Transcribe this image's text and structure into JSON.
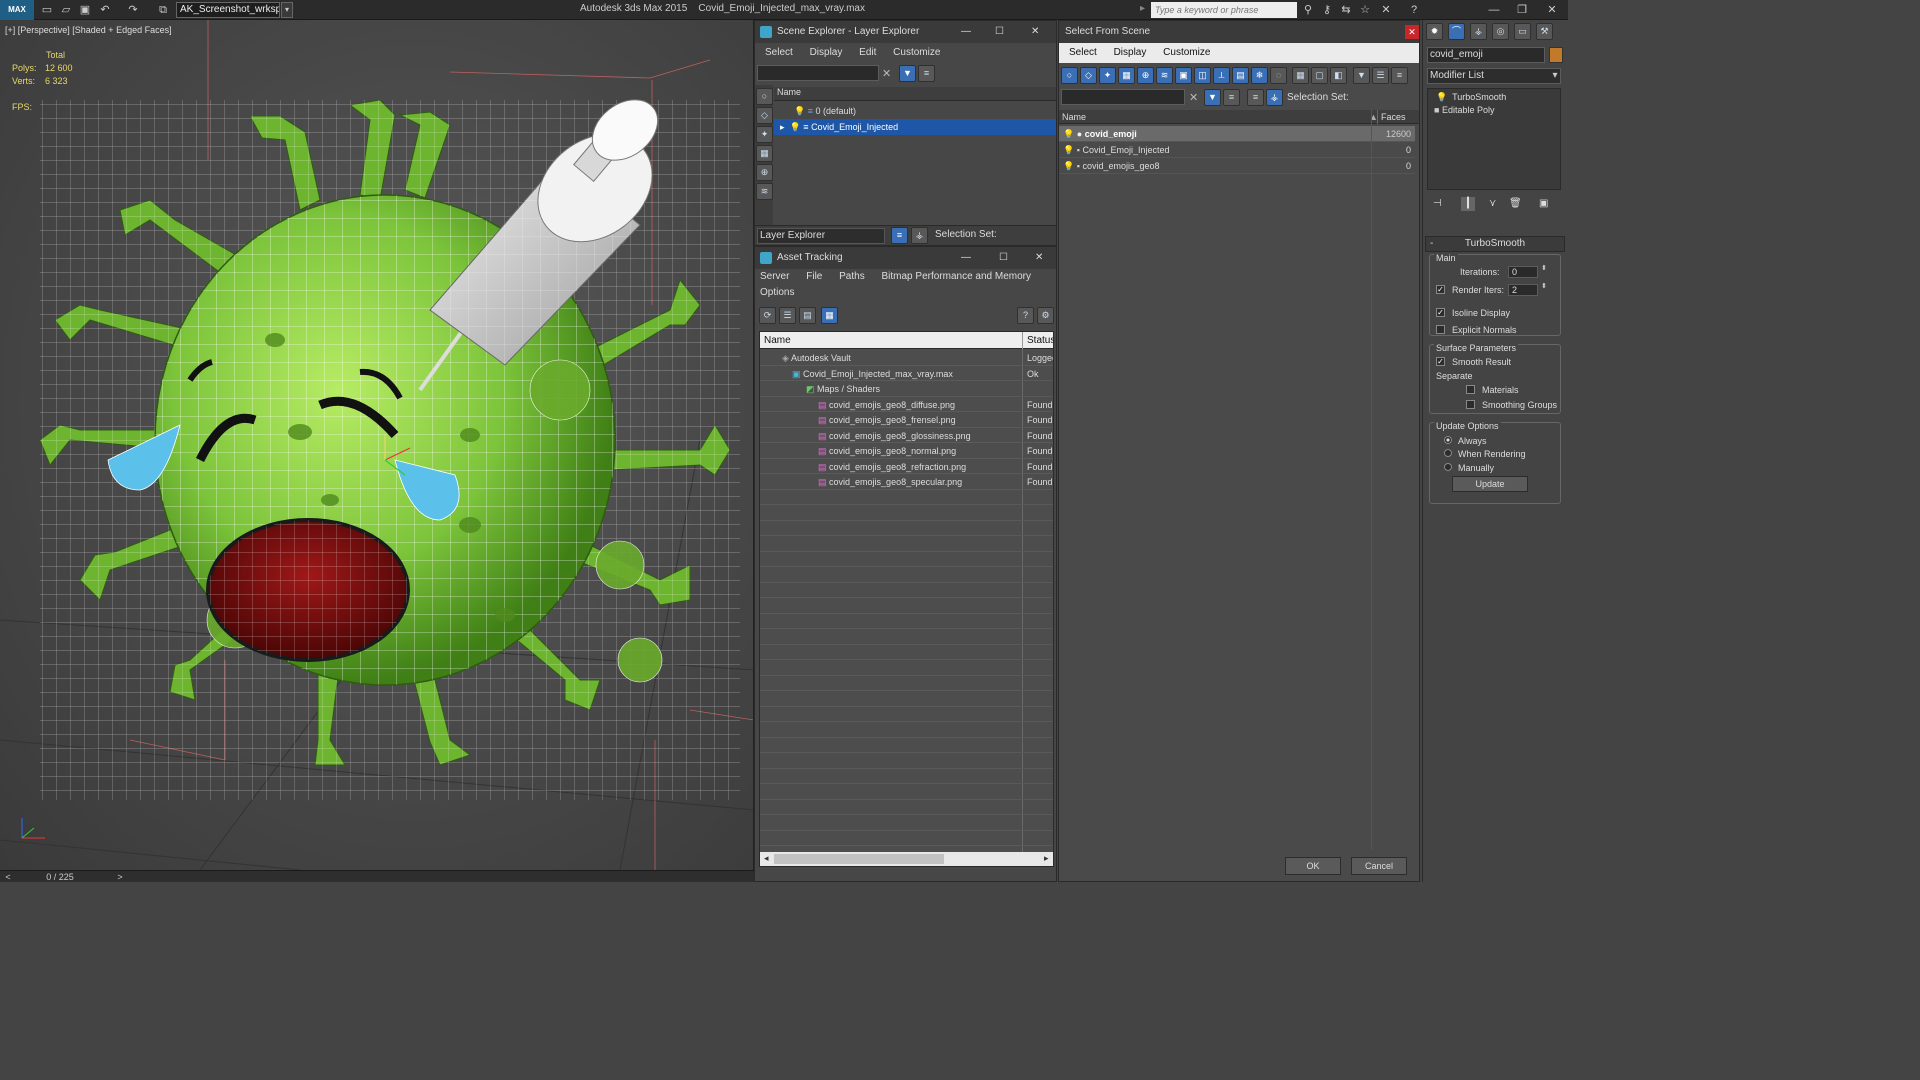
{
  "titlebar": {
    "workspace": "AK_Screenshot_wrksp",
    "app_name": "Autodesk 3ds Max  2015",
    "file_name": "Covid_Emoji_Injected_max_vray.max",
    "search_placeholder": "Type a keyword or phrase"
  },
  "viewport": {
    "label": "[+] [Perspective] [Shaded + Edged Faces]",
    "stats": {
      "total": "Total",
      "polys_label": "Polys:",
      "polys": "12 600",
      "verts_label": "Verts:",
      "verts": "6 323",
      "fps": "FPS:"
    }
  },
  "timeline": {
    "frame": "0 / 225",
    "prev": "<",
    "next": ">"
  },
  "scene_explorer": {
    "title": "Scene Explorer - Layer Explorer",
    "menu": [
      "Select",
      "Display",
      "Edit",
      "Customize"
    ],
    "col_name": "Name",
    "layers": [
      "0 (default)",
      "Covid_Emoji_Injected"
    ],
    "footer_label": "Layer Explorer",
    "selection_set": "Selection Set:"
  },
  "asset_tracking": {
    "title": "Asset Tracking",
    "menu": [
      "Server",
      "File",
      "Paths",
      "Bitmap Performance and Memory"
    ],
    "menu2": "Options",
    "col_name": "Name",
    "col_status": "Status",
    "rows": [
      {
        "name": "Autodesk Vault",
        "status": "Logged"
      },
      {
        "name": "Covid_Emoji_Injected_max_vray.max",
        "status": "Ok"
      },
      {
        "name": "Maps / Shaders",
        "status": ""
      },
      {
        "name": "covid_emojis_geo8_diffuse.png",
        "status": "Found"
      },
      {
        "name": "covid_emojis_geo8_frensel.png",
        "status": "Found"
      },
      {
        "name": "covid_emojis_geo8_glossiness.png",
        "status": "Found"
      },
      {
        "name": "covid_emojis_geo8_normal.png",
        "status": "Found"
      },
      {
        "name": "covid_emojis_geo8_refraction.png",
        "status": "Found"
      },
      {
        "name": "covid_emojis_geo8_specular.png",
        "status": "Found"
      }
    ]
  },
  "select_from_scene": {
    "title": "Select From Scene",
    "menu": [
      "Select",
      "Display",
      "Customize"
    ],
    "selection_set": "Selection Set:",
    "col_name": "Name",
    "col_faces": "Faces",
    "rows": [
      {
        "name": "covid_emoji",
        "faces": "12600"
      },
      {
        "name": "Covid_Emoji_Injected",
        "faces": "0"
      },
      {
        "name": "covid_emojis_geo8",
        "faces": "0"
      }
    ],
    "ok": "OK",
    "cancel": "Cancel"
  },
  "command_panel": {
    "object_name": "covid_emoji",
    "modifier_list": "Modifier List",
    "stack": [
      "TurboSmooth",
      "Editable Poly"
    ],
    "rollout_title": "TurboSmooth",
    "main": "Main",
    "iterations_label": "Iterations:",
    "iterations": "0",
    "render_iters_label": "Render Iters:",
    "render_iters": "2",
    "isoline": "Isoline Display",
    "explicit_normals": "Explicit Normals",
    "surface_params": "Surface Parameters",
    "smooth_result": "Smooth Result",
    "separate": "Separate",
    "materials": "Materials",
    "smoothing_groups": "Smoothing Groups",
    "update_options": "Update Options",
    "always": "Always",
    "when_rendering": "When Rendering",
    "manually": "Manually",
    "update": "Update"
  },
  "colors": {
    "accent": "#1e56a8",
    "virus_green": "#7cc43a",
    "stats_yellow": "#e8d76a"
  }
}
